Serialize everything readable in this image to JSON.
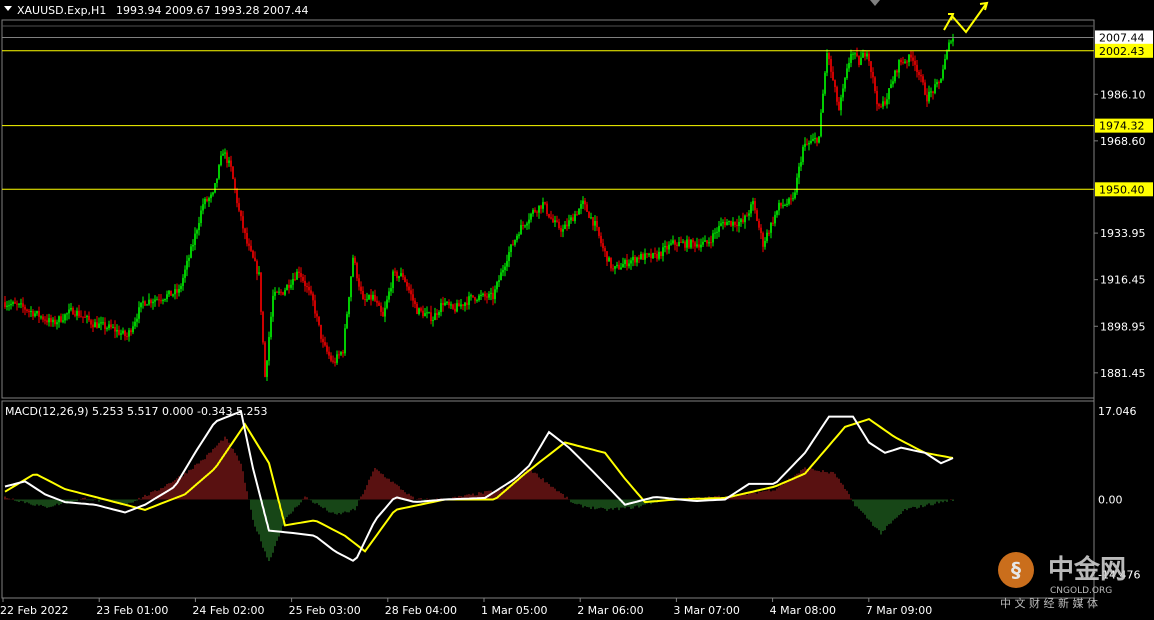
{
  "header": {
    "symbol": "XAUUSD.Exp,H1",
    "ohlc": "1993.94 2009.67 1993.28 2007.44"
  },
  "colors": {
    "background": "#000000",
    "bull": "#00ff00",
    "bear": "#ff0000",
    "level_line": "#ffff00",
    "macd_main": "#ffffff",
    "macd_signal": "#ffff00",
    "hist_pos": "#b22222",
    "hist_neg": "#2e8b2e",
    "text": "#ffffff",
    "frame": "#808080"
  },
  "price_axis": {
    "ticks": [
      "1986.10",
      "1968.60",
      "1933.95",
      "1916.45",
      "1898.95",
      "1881.45"
    ],
    "ylim": [
      1872,
      2014
    ]
  },
  "levels": [
    {
      "label": "2007.44",
      "value": 2007.44,
      "style": "current"
    },
    {
      "label": "2002.43",
      "value": 2002.43,
      "style": "yellow"
    },
    {
      "label": "1974.32",
      "value": 1974.32,
      "style": "yellow"
    },
    {
      "label": "1950.40",
      "value": 1950.4,
      "style": "yellow"
    }
  ],
  "macd": {
    "title": "MACD(12,26,9) 5.253 5.517 0.000 -0.343 5.253",
    "ticks": [
      "17.046",
      "0.00",
      "-14.476"
    ],
    "ylim": [
      -19,
      19
    ]
  },
  "time_axis": {
    "labels": [
      "22 Feb 2022",
      "23 Feb 01:00",
      "24 Feb 02:00",
      "25 Feb 03:00",
      "28 Feb 04:00",
      "1 Mar 05:00",
      "2 Mar 06:00",
      "3 Mar 07:00",
      "4 Mar 08:00",
      "7 Mar 09:00"
    ]
  },
  "watermark": {
    "brand": "中金网",
    "sub": "CNGOLD.ORG",
    "tagline": "中 文 财 经 新 媒 体"
  },
  "chart_data": {
    "type": "candlestick",
    "price_keypoints": [
      [
        0,
        1908
      ],
      [
        10,
        1906
      ],
      [
        18,
        1903
      ],
      [
        25,
        1900
      ],
      [
        35,
        1905
      ],
      [
        45,
        1900
      ],
      [
        55,
        1898
      ],
      [
        62,
        1895
      ],
      [
        70,
        1908
      ],
      [
        80,
        1910
      ],
      [
        88,
        1912
      ],
      [
        95,
        1930
      ],
      [
        100,
        1945
      ],
      [
        105,
        1948
      ],
      [
        110,
        1965
      ],
      [
        114,
        1958
      ],
      [
        118,
        1942
      ],
      [
        122,
        1930
      ],
      [
        128,
        1918
      ],
      [
        131,
        1880
      ],
      [
        135,
        1910
      ],
      [
        140,
        1912
      ],
      [
        148,
        1920
      ],
      [
        155,
        1908
      ],
      [
        160,
        1892
      ],
      [
        165,
        1885
      ],
      [
        170,
        1890
      ],
      [
        175,
        1925
      ],
      [
        180,
        1908
      ],
      [
        185,
        1910
      ],
      [
        190,
        1902
      ],
      [
        195,
        1918
      ],
      [
        200,
        1918
      ],
      [
        207,
        1905
      ],
      [
        215,
        1902
      ],
      [
        220,
        1908
      ],
      [
        225,
        1905
      ],
      [
        235,
        1910
      ],
      [
        245,
        1910
      ],
      [
        252,
        1925
      ],
      [
        258,
        1935
      ],
      [
        265,
        1942
      ],
      [
        270,
        1945
      ],
      [
        275,
        1938
      ],
      [
        280,
        1935
      ],
      [
        290,
        1945
      ],
      [
        296,
        1937
      ],
      [
        300,
        1928
      ],
      [
        305,
        1920
      ],
      [
        312,
        1923
      ],
      [
        318,
        1925
      ],
      [
        326,
        1925
      ],
      [
        335,
        1930
      ],
      [
        345,
        1930
      ],
      [
        352,
        1930
      ],
      [
        360,
        1938
      ],
      [
        370,
        1938
      ],
      [
        375,
        1945
      ],
      [
        380,
        1930
      ],
      [
        388,
        1944
      ],
      [
        395,
        1946
      ],
      [
        400,
        1966
      ],
      [
        408,
        1970
      ],
      [
        412,
        2002
      ],
      [
        418,
        1980
      ],
      [
        424,
        2002
      ],
      [
        428,
        1998
      ],
      [
        432,
        2003
      ],
      [
        438,
        1980
      ],
      [
        442,
        1985
      ],
      [
        448,
        1998
      ],
      [
        455,
        2000
      ],
      [
        462,
        1985
      ],
      [
        468,
        1990
      ],
      [
        474,
        2007.44
      ]
    ],
    "macd_main_keypoints": [
      [
        0,
        2.5
      ],
      [
        10,
        3.5
      ],
      [
        20,
        1
      ],
      [
        30,
        -0.5
      ],
      [
        45,
        -1
      ],
      [
        60,
        -2.5
      ],
      [
        70,
        -1
      ],
      [
        85,
        2.5
      ],
      [
        95,
        9
      ],
      [
        105,
        15
      ],
      [
        118,
        17
      ],
      [
        124,
        6
      ],
      [
        132,
        -6
      ],
      [
        145,
        -6.5
      ],
      [
        155,
        -7
      ],
      [
        165,
        -10
      ],
      [
        175,
        -12
      ],
      [
        185,
        -4
      ],
      [
        195,
        0.5
      ],
      [
        205,
        -0.5
      ],
      [
        220,
        0
      ],
      [
        240,
        0.3
      ],
      [
        255,
        4
      ],
      [
        262,
        6.5
      ],
      [
        272,
        13
      ],
      [
        282,
        10
      ],
      [
        295,
        5
      ],
      [
        310,
        -1
      ],
      [
        325,
        0.5
      ],
      [
        345,
        -0.3
      ],
      [
        360,
        0
      ],
      [
        372,
        3
      ],
      [
        385,
        3
      ],
      [
        400,
        9
      ],
      [
        412,
        16
      ],
      [
        424,
        16
      ],
      [
        432,
        11
      ],
      [
        440,
        9
      ],
      [
        448,
        10
      ],
      [
        460,
        9
      ],
      [
        468,
        7
      ],
      [
        474,
        8
      ]
    ],
    "macd_signal_keypoints": [
      [
        0,
        1.5
      ],
      [
        15,
        5
      ],
      [
        30,
        2
      ],
      [
        50,
        0
      ],
      [
        70,
        -2
      ],
      [
        90,
        1
      ],
      [
        105,
        6
      ],
      [
        120,
        14.5
      ],
      [
        132,
        7
      ],
      [
        140,
        -5
      ],
      [
        155,
        -4
      ],
      [
        170,
        -7
      ],
      [
        180,
        -10
      ],
      [
        195,
        -2
      ],
      [
        220,
        0
      ],
      [
        245,
        0
      ],
      [
        260,
        5
      ],
      [
        280,
        11
      ],
      [
        300,
        9
      ],
      [
        310,
        4
      ],
      [
        320,
        -0.5
      ],
      [
        335,
        0
      ],
      [
        360,
        0.3
      ],
      [
        385,
        2.5
      ],
      [
        400,
        5
      ],
      [
        420,
        14
      ],
      [
        432,
        15.5
      ],
      [
        445,
        12
      ],
      [
        460,
        9
      ],
      [
        474,
        8
      ]
    ],
    "histogram_keypoints": [
      [
        0,
        0.5
      ],
      [
        20,
        -1.5
      ],
      [
        40,
        0.2
      ],
      [
        60,
        -1
      ],
      [
        75,
        1.5
      ],
      [
        90,
        5
      ],
      [
        100,
        8
      ],
      [
        110,
        12
      ],
      [
        118,
        7
      ],
      [
        124,
        -4
      ],
      [
        132,
        -12
      ],
      [
        140,
        -4
      ],
      [
        150,
        0.5
      ],
      [
        165,
        -3
      ],
      [
        175,
        -2
      ],
      [
        185,
        6
      ],
      [
        195,
        3
      ],
      [
        205,
        0
      ],
      [
        220,
        0
      ],
      [
        250,
        2
      ],
      [
        262,
        6
      ],
      [
        272,
        3
      ],
      [
        285,
        -1
      ],
      [
        300,
        -2
      ],
      [
        315,
        -1.5
      ],
      [
        330,
        0
      ],
      [
        350,
        0.3
      ],
      [
        370,
        1
      ],
      [
        385,
        2
      ],
      [
        400,
        6
      ],
      [
        415,
        5
      ],
      [
        425,
        -1
      ],
      [
        438,
        -6.5
      ],
      [
        450,
        -2
      ],
      [
        462,
        -1
      ],
      [
        474,
        0
      ]
    ]
  }
}
